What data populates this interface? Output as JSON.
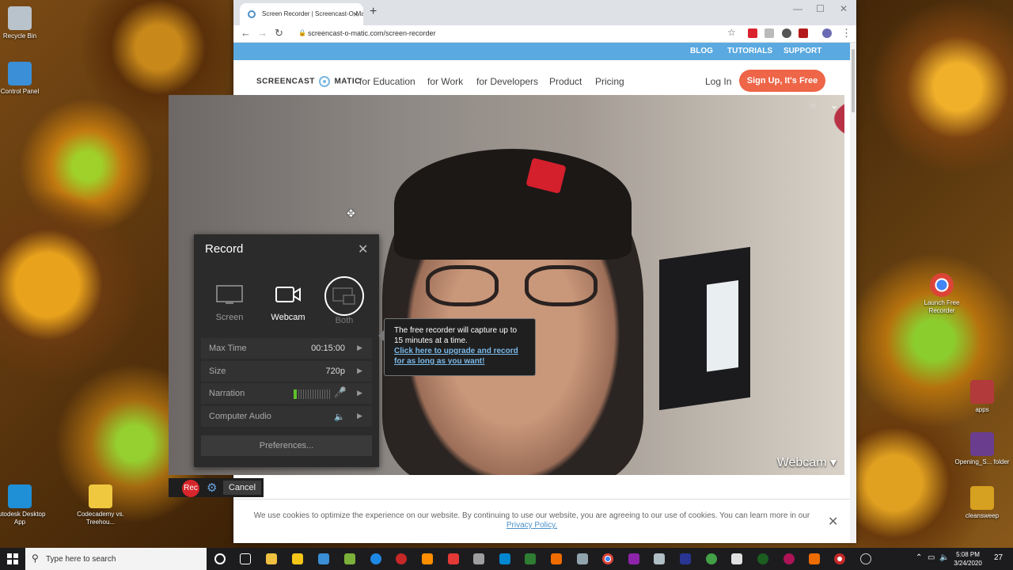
{
  "desktop_icons": [
    {
      "label": "Recycle Bin",
      "icon": "recycle-bin-icon",
      "color": "#b9c3cc"
    },
    {
      "label": "Control Panel",
      "icon": "control-panel-icon",
      "color": "#3a8fd6"
    },
    {
      "label": "Autodesk Desktop App",
      "icon": "autodesk-icon",
      "color": "#1f8fd6"
    },
    {
      "label": "Codecademy vs. Treehou...",
      "icon": "zip-folder-icon",
      "color": "#f0c840"
    },
    {
      "label": "Launch Free Recorder",
      "icon": "chrome-icon",
      "color": "#db4437"
    },
    {
      "label": "apps",
      "icon": "winrar-icon",
      "color": "#b33a3a"
    },
    {
      "label": "Opening_S... folder",
      "icon": "winrar-icon",
      "color": "#6a3d8f"
    },
    {
      "label": "cleansweep",
      "icon": "winrar-icon",
      "color": "#d6a020"
    }
  ],
  "browser": {
    "tab_title": "Screen Recorder | Screencast-O-Matic",
    "new_tab": "+",
    "url": "screencast-o-matic.com/screen-recorder",
    "window_controls": [
      "—",
      "☐",
      "✕"
    ]
  },
  "site": {
    "top_links": [
      "BLOG",
      "TUTORIALS",
      "SUPPORT"
    ],
    "logo_left": "SCREENCAST",
    "logo_right": "MATIC",
    "nav": [
      "for Education",
      "for Work",
      "for Developers",
      "Product",
      "Pricing"
    ],
    "login": "Log In",
    "signup": "Sign Up, It's Free",
    "accent_color": "#5aa9e0",
    "cta_color": "#ee6548",
    "cookie_text": "We use cookies to optimize the experience on our website. By continuing to use our website, you are agreeing to our use of cookies. You can learn more in our",
    "cookie_link": "Privacy Policy."
  },
  "webcam": {
    "label": "Webcam ▾"
  },
  "record_panel": {
    "title": "Record",
    "modes": [
      {
        "label": "Screen",
        "state": "inactive"
      },
      {
        "label": "Webcam",
        "state": "active"
      },
      {
        "label": "Both",
        "state": "hovered"
      }
    ],
    "rows": [
      {
        "label": "Max Time",
        "value": "00:15:00"
      },
      {
        "label": "Size",
        "value": "720p"
      },
      {
        "label": "Narration",
        "level": 0.08
      },
      {
        "label": "Computer Audio",
        "value": "muted"
      }
    ],
    "preferences": "Preferences..."
  },
  "tooltip": {
    "text": "The free recorder will capture up to 15 minutes at a time.",
    "link": "Click here to upgrade and record for as long as you want!"
  },
  "recbar": {
    "rec": "Rec",
    "cancel": "Cancel"
  },
  "taskbar": {
    "search_placeholder": "Type here to search",
    "time": "5:08 PM",
    "date": "3/24/2020",
    "notifications": "27"
  }
}
